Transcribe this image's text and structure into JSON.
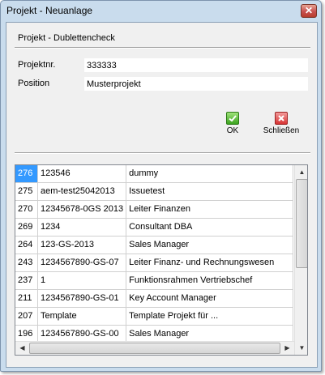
{
  "window": {
    "title": "Projekt - Neuanlage",
    "close_glyph": "✕"
  },
  "section_title": "Projekt - Dublettencheck",
  "fields": {
    "projektnr_label": "Projektnr.",
    "projektnr_value": "333333",
    "position_label": "Position",
    "position_value": "Musterprojekt"
  },
  "toolbar": {
    "ok_label": "OK",
    "close_label": "Schließen",
    "ok_icon": "check-icon",
    "close_icon": "x-icon"
  },
  "grid": {
    "rows": [
      {
        "id": "276",
        "nr": "123546",
        "name": "dummy"
      },
      {
        "id": "275",
        "nr": "aem-test25042013",
        "name": "Issuetest"
      },
      {
        "id": "270",
        "nr": "12345678-0GS 2013",
        "name": "Leiter Finanzen"
      },
      {
        "id": "269",
        "nr": "1234",
        "name": "Consultant DBA"
      },
      {
        "id": "264",
        "nr": "123-GS-2013",
        "name": "Sales Manager"
      },
      {
        "id": "243",
        "nr": "1234567890-GS-07",
        "name": "Leiter Finanz- und Rechnungswesen"
      },
      {
        "id": "237",
        "nr": "1",
        "name": "Funktionsrahmen Vertriebschef"
      },
      {
        "id": "211",
        "nr": "1234567890-GS-01",
        "name": "Key Account Manager"
      },
      {
        "id": "207",
        "nr": "Template",
        "name": "Template Projekt für ..."
      },
      {
        "id": "196",
        "nr": "1234567890-GS-00",
        "name": "Sales Manager"
      }
    ]
  },
  "colors": {
    "selection": "#3399ff",
    "frame": "#c9dced"
  }
}
